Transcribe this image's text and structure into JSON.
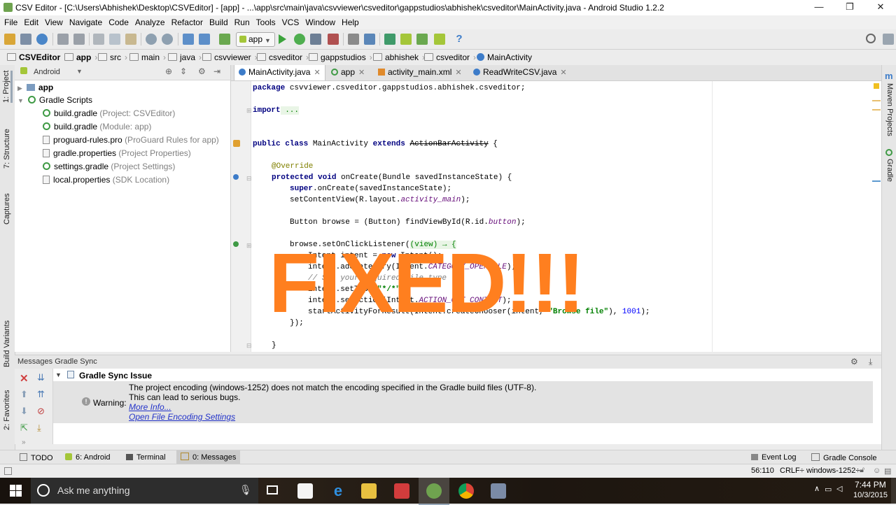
{
  "window": {
    "title": "CSV Editor - [C:\\Users\\Abhishek\\Desktop\\CSVEditor] - [app] - ...\\app\\src\\main\\java\\csvviewer\\csveditor\\gappstudios\\abhishek\\csveditor\\MainActivity.java - Android Studio 1.2.2",
    "controls": {
      "minimize": "—",
      "restore": "❐",
      "close": "✕"
    }
  },
  "menu": [
    "File",
    "Edit",
    "View",
    "Navigate",
    "Code",
    "Analyze",
    "Refactor",
    "Build",
    "Run",
    "Tools",
    "VCS",
    "Window",
    "Help"
  ],
  "toolbar": {
    "run_config": "app",
    "help": "?"
  },
  "breadcrumb": [
    "CSVEditor",
    "app",
    "src",
    "main",
    "java",
    "csvviewer",
    "csveditor",
    "gappstudios",
    "abhishek",
    "csveditor",
    "MainActivity"
  ],
  "project_panel": {
    "view_selector": "Android",
    "items": [
      {
        "label": "app",
        "hint": ""
      },
      {
        "label": "Gradle Scripts",
        "hint": ""
      },
      {
        "label": "build.gradle",
        "hint": "(Project: CSVEditor)"
      },
      {
        "label": "build.gradle",
        "hint": "(Module: app)"
      },
      {
        "label": "proguard-rules.pro",
        "hint": "(ProGuard Rules for app)"
      },
      {
        "label": "gradle.properties",
        "hint": "(Project Properties)"
      },
      {
        "label": "settings.gradle",
        "hint": "(Project Settings)"
      },
      {
        "label": "local.properties",
        "hint": "(SDK Location)"
      }
    ]
  },
  "left_strip": {
    "project": "1: Project",
    "structure": "7: Structure",
    "captures": "Captures",
    "build_variants": "Build Variants",
    "favorites": "2: Favorites"
  },
  "right_strip": {
    "maven": "Maven Projects",
    "gradle": "Gradle"
  },
  "editor_tabs": [
    {
      "label": "MainActivity.java",
      "active": true
    },
    {
      "label": "app",
      "active": false
    },
    {
      "label": "activity_main.xml",
      "active": false
    },
    {
      "label": "ReadWriteCSV.java",
      "active": false
    }
  ],
  "code": {
    "l1_kw": "package",
    "l1": " csvviewer.csveditor.gappstudios.abhishek.csveditor;",
    "l2_kw": "import",
    "l2_fold": " ...",
    "l3_kw": "public class",
    "l3": " MainActivity ",
    "l3_kw2": "extends",
    "l3_strike": "ActionBarActivity",
    "l3_end": " {",
    "l4": "@Override",
    "l5_kw": "protected void",
    "l5": " onCreate(Bundle savedInstanceState) {",
    "l6_kw": "super",
    "l6": ".onCreate(savedInstanceState);",
    "l7": "setContentView(R.layout.",
    "l7_fld": "activity_main",
    "l7_end": ");",
    "l8": "Button browse = (Button) findViewById(R.id.",
    "l8_fld": "button",
    "l8_end": ");",
    "l9": "browse.setOnClickListener(",
    "l9_fold": "(view) → {",
    "l10_kw": "Intent",
    "l10": " intent = ",
    "l10_kw2": "new",
    "l10_end": " Intent();",
    "l11": "intent.addCategory(Intent.",
    "l11_fld": "CATEGORY_OPENABLE",
    "l11_end": ");",
    "l12": "// Set your required file type",
    "l13": "intent.setType(",
    "l13_str": "\"*/*\"",
    "l13_end": ");",
    "l14": "intent.setAction(Intent.",
    "l14_fld": "ACTION_GET_CONTENT",
    "l14_end": ");",
    "l15": "startActivityForResult(Intent.createChooser(intent, ",
    "l15_str": "\"Browse file\"",
    "l15_mid": "), ",
    "l15_num": "1001",
    "l15_end": ");",
    "l16": "});",
    "l17": "}"
  },
  "overlay_text": "FIXED!!!",
  "messages": {
    "header": "Messages Gradle Sync",
    "issue_title": "Gradle Sync Issue",
    "warning_label": "Warning:",
    "line1": "The project encoding (windows-1252) does not match the encoding specified in the Gradle build files (UTF-8).",
    "line2": "This can lead to serious bugs.",
    "link1": "More Info...",
    "link2": "Open File Encoding Settings"
  },
  "bottom_tools": {
    "todo": "TODO",
    "android": "6: Android",
    "terminal": "Terminal",
    "messages": "0: Messages",
    "event_log": "Event Log",
    "gradle_console": "Gradle Console"
  },
  "status": {
    "position": "56:110",
    "line_sep": "CRLF÷",
    "encoding": "windows-1252÷"
  },
  "taskbar": {
    "search_placeholder": "Ask me anything",
    "time": "7:44 PM",
    "date": "10/3/2015"
  },
  "colors": {
    "accent_orange": "#ff7f1f",
    "android_green": "#a4c639",
    "link_blue": "#2333c9"
  }
}
